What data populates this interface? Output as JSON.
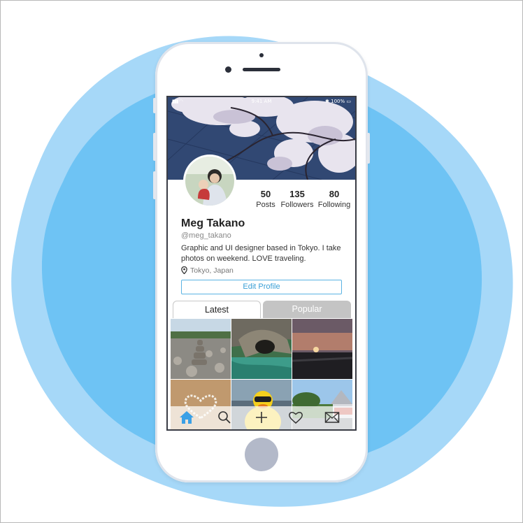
{
  "status_bar": {
    "time": "9:41 AM",
    "battery": "100%"
  },
  "profile": {
    "name": "Meg Takano",
    "handle": "@meg_takano",
    "bio": "Graphic and UI designer based in Tokyo. I take photos on weekend. LOVE traveling.",
    "location": "Tokyo, Japan",
    "edit_label": "Edit Profile",
    "stats": [
      {
        "value": "50",
        "label": "Posts"
      },
      {
        "value": "135",
        "label": "Followers"
      },
      {
        "value": "80",
        "label": "Following"
      }
    ]
  },
  "tabs": [
    {
      "label": "Latest",
      "active": true
    },
    {
      "label": "Popular",
      "active": false
    }
  ],
  "nav": [
    {
      "icon": "home-icon",
      "active": true
    },
    {
      "icon": "search-icon",
      "active": false
    },
    {
      "icon": "plus-icon",
      "active": false
    },
    {
      "icon": "heart-icon",
      "active": false
    },
    {
      "icon": "mail-icon",
      "active": false
    }
  ],
  "colors": {
    "accent": "#3a9fd6",
    "blob_light": "#a6d8f8",
    "blob_dark": "#6ec3f4",
    "tab_inactive": "#c4c4c4"
  }
}
